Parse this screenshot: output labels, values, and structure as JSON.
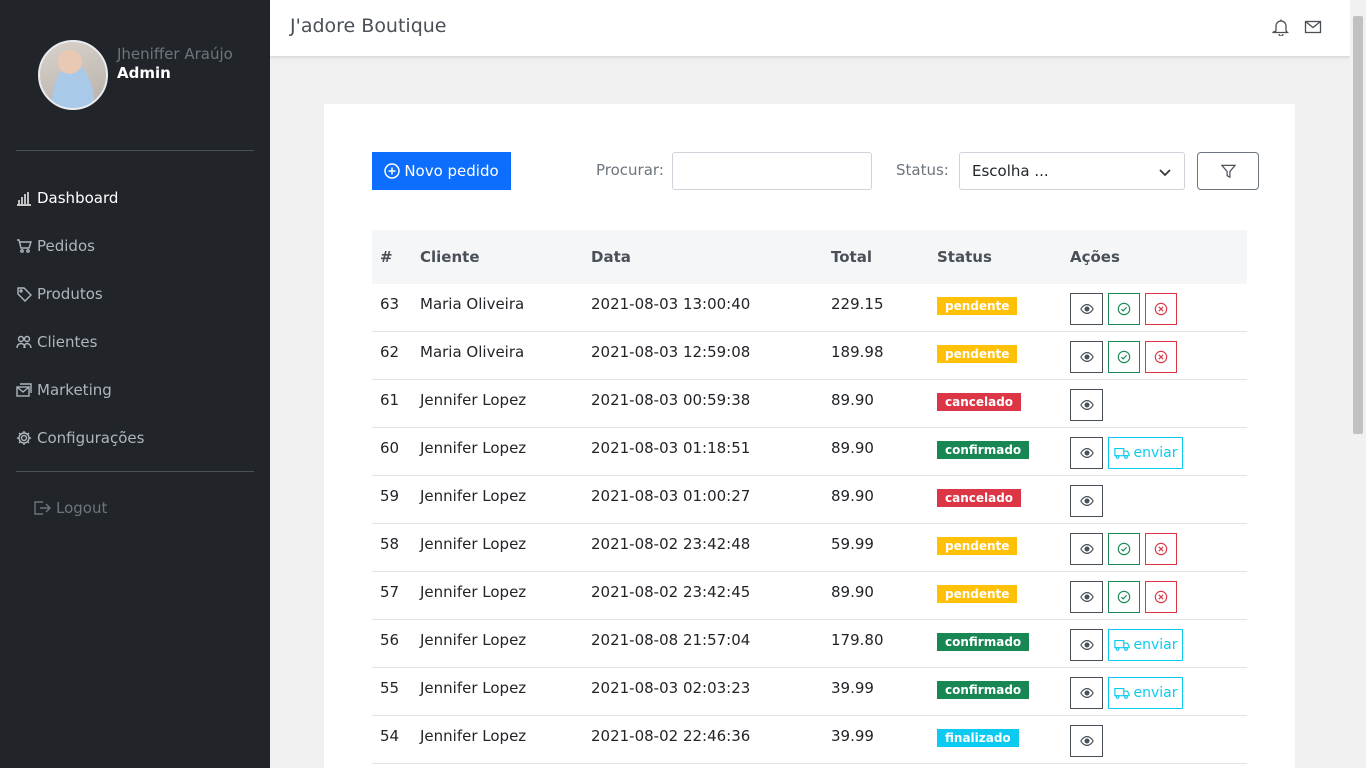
{
  "app": {
    "title": "J'adore Boutique"
  },
  "profile": {
    "name": "Jheniffer Araújo",
    "role": "Admin"
  },
  "menu": [
    {
      "label": "Dashboard",
      "icon": "bar-chart-icon",
      "active": true
    },
    {
      "label": "Pedidos",
      "icon": "cart-icon",
      "active": false
    },
    {
      "label": "Produtos",
      "icon": "tag-icon",
      "active": false
    },
    {
      "label": "Clientes",
      "icon": "people-icon",
      "active": false
    },
    {
      "label": "Marketing",
      "icon": "mail-stack-icon",
      "active": false
    },
    {
      "label": "Configurações",
      "icon": "gear-icon",
      "active": false
    }
  ],
  "logout": {
    "label": "Logout"
  },
  "toolbar": {
    "new_order_label": "Novo pedido",
    "search_label": "Procurar:",
    "search_value": "",
    "status_label": "Status:",
    "status_selected": "Escolha ..."
  },
  "table": {
    "headers": [
      "#",
      "Cliente",
      "Data",
      "Total",
      "Status",
      "Ações"
    ],
    "action_send_label": "enviar",
    "rows": [
      {
        "id": "63",
        "client": "Maria Oliveira",
        "date": "2021-08-03 13:00:40",
        "total": "229.15",
        "status": "pendente",
        "status_kind": "pend"
      },
      {
        "id": "62",
        "client": "Maria Oliveira",
        "date": "2021-08-03 12:59:08",
        "total": "189.98",
        "status": "pendente",
        "status_kind": "pend"
      },
      {
        "id": "61",
        "client": "Jennifer Lopez",
        "date": "2021-08-03 00:59:38",
        "total": "89.90",
        "status": "cancelado",
        "status_kind": "canc"
      },
      {
        "id": "60",
        "client": "Jennifer Lopez",
        "date": "2021-08-03 01:18:51",
        "total": "89.90",
        "status": "confirmado",
        "status_kind": "conf"
      },
      {
        "id": "59",
        "client": "Jennifer Lopez",
        "date": "2021-08-03 01:00:27",
        "total": "89.90",
        "status": "cancelado",
        "status_kind": "canc"
      },
      {
        "id": "58",
        "client": "Jennifer Lopez",
        "date": "2021-08-02 23:42:48",
        "total": "59.99",
        "status": "pendente",
        "status_kind": "pend"
      },
      {
        "id": "57",
        "client": "Jennifer Lopez",
        "date": "2021-08-02 23:42:45",
        "total": "89.90",
        "status": "pendente",
        "status_kind": "pend"
      },
      {
        "id": "56",
        "client": "Jennifer Lopez",
        "date": "2021-08-08 21:57:04",
        "total": "179.80",
        "status": "confirmado",
        "status_kind": "conf"
      },
      {
        "id": "55",
        "client": "Jennifer Lopez",
        "date": "2021-08-03 02:03:23",
        "total": "39.99",
        "status": "confirmado",
        "status_kind": "conf"
      },
      {
        "id": "54",
        "client": "Jennifer Lopez",
        "date": "2021-08-02 22:46:36",
        "total": "39.99",
        "status": "finalizado",
        "status_kind": "fin"
      }
    ]
  },
  "colors": {
    "sidebar": "#212529",
    "primary": "#0d6efd",
    "pendente": "#ffc107",
    "cancelado": "#dc3545",
    "confirmado": "#198754",
    "finalizado": "#0dcaf0"
  }
}
